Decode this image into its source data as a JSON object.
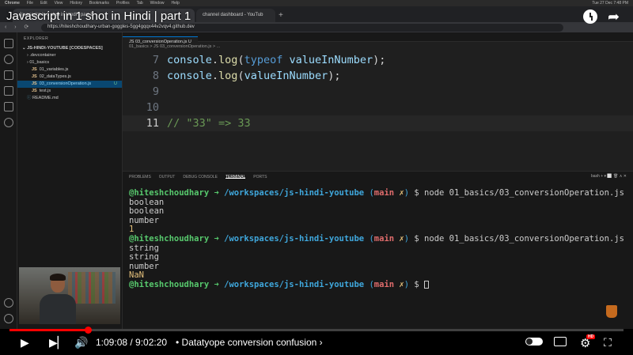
{
  "macbar": {
    "left": [
      "Chrome",
      "File",
      "Edit",
      "View",
      "History",
      "Bookmarks",
      "Profiles",
      "Tab",
      "Window",
      "Help"
    ],
    "clock": "Tue 27 Dec  7:48 PM"
  },
  "browser": {
    "tab_active": "Javascript in 1 shot in Hindi | part 1",
    "tab_other": "channel dashboard - YouTub",
    "url": "https://hiteshchoudhary-urban-goggles-5gg4gqqx44v2vqv4.github.dev"
  },
  "explorer": {
    "header": "EXPLORER",
    "project": "JS-HINDI-YOUTUBE [CODESPACES]",
    "items": [
      {
        "label": ".devcontainer",
        "type": "folder",
        "indent": 1
      },
      {
        "label": "01_basics",
        "type": "folder",
        "indent": 1
      },
      {
        "label": "01_variables.js",
        "type": "js",
        "indent": 2
      },
      {
        "label": "02_dataTypes.js",
        "type": "js",
        "indent": 2
      },
      {
        "label": "03_conversionOperation.js",
        "type": "js",
        "indent": 2,
        "active": true,
        "mod": "U"
      },
      {
        "label": "test.js",
        "type": "js",
        "indent": 2
      },
      {
        "label": "README.md",
        "type": "md",
        "indent": 1
      }
    ]
  },
  "editor": {
    "tab": "JS 03_conversionOperation.js U",
    "breadcrumb": "01_basics > JS 03_conversionOperation.js > ...",
    "lines": [
      {
        "num": "7",
        "parts": [
          {
            "t": "console",
            "c": "v"
          },
          {
            "t": ".",
            "c": ""
          },
          {
            "t": "log",
            "c": "f"
          },
          {
            "t": "(",
            "c": ""
          },
          {
            "t": "typeof",
            "c": "k"
          },
          {
            "t": " ",
            "c": ""
          },
          {
            "t": "valueInNumber",
            "c": "v"
          },
          {
            "t": ");",
            "c": ""
          }
        ]
      },
      {
        "num": "8",
        "parts": [
          {
            "t": "console",
            "c": "v"
          },
          {
            "t": ".",
            "c": ""
          },
          {
            "t": "log",
            "c": "f"
          },
          {
            "t": "(",
            "c": ""
          },
          {
            "t": "valueInNumber",
            "c": "v"
          },
          {
            "t": ");",
            "c": ""
          }
        ]
      },
      {
        "num": "9",
        "parts": []
      },
      {
        "num": "10",
        "parts": []
      },
      {
        "num": "11",
        "parts": [
          {
            "t": "// \"33\" => 33",
            "c": "c"
          }
        ],
        "current": true
      }
    ]
  },
  "panel": {
    "tabs": [
      "PROBLEMS",
      "OUTPUT",
      "DEBUG CONSOLE",
      "TERMINAL",
      "PORTS"
    ],
    "active_tab": "TERMINAL",
    "tools": "bash  +  ▾  ⬜  🗑  ∧  ✕"
  },
  "terminal": {
    "user": "@hiteshchoudhary",
    "arrow": "➜",
    "path": "/workspaces/js-hindi-youtube",
    "branch": "main",
    "dirty": "✗",
    "dollar": "$",
    "command": "node 01_basics/03_conversionOperation.js",
    "runs": [
      {
        "output": [
          "boolean",
          "boolean",
          "number",
          "1"
        ],
        "numeric_last": true
      },
      {
        "output": [
          "string",
          "string",
          "number",
          "NaN"
        ],
        "numeric_last": true
      }
    ]
  },
  "youtube": {
    "title": "Javascript in 1 shot in Hindi | part 1",
    "current_time": "1:09:08",
    "duration": "9:02:20",
    "time_display": "1:09:08 / 9:02:20",
    "chapter": "• Datatyope conversion confusion ›",
    "progress_fraction": 0.1274,
    "hd_badge": "HD",
    "colors": {
      "progress": "#ff0000",
      "accent": "#ff0000"
    }
  },
  "icons": [
    "clock-icon",
    "share-icon",
    "play-icon",
    "next-icon",
    "volume-icon",
    "autoplay-toggle-icon",
    "captions-icon",
    "settings-gear-icon",
    "fullscreen-icon"
  ]
}
